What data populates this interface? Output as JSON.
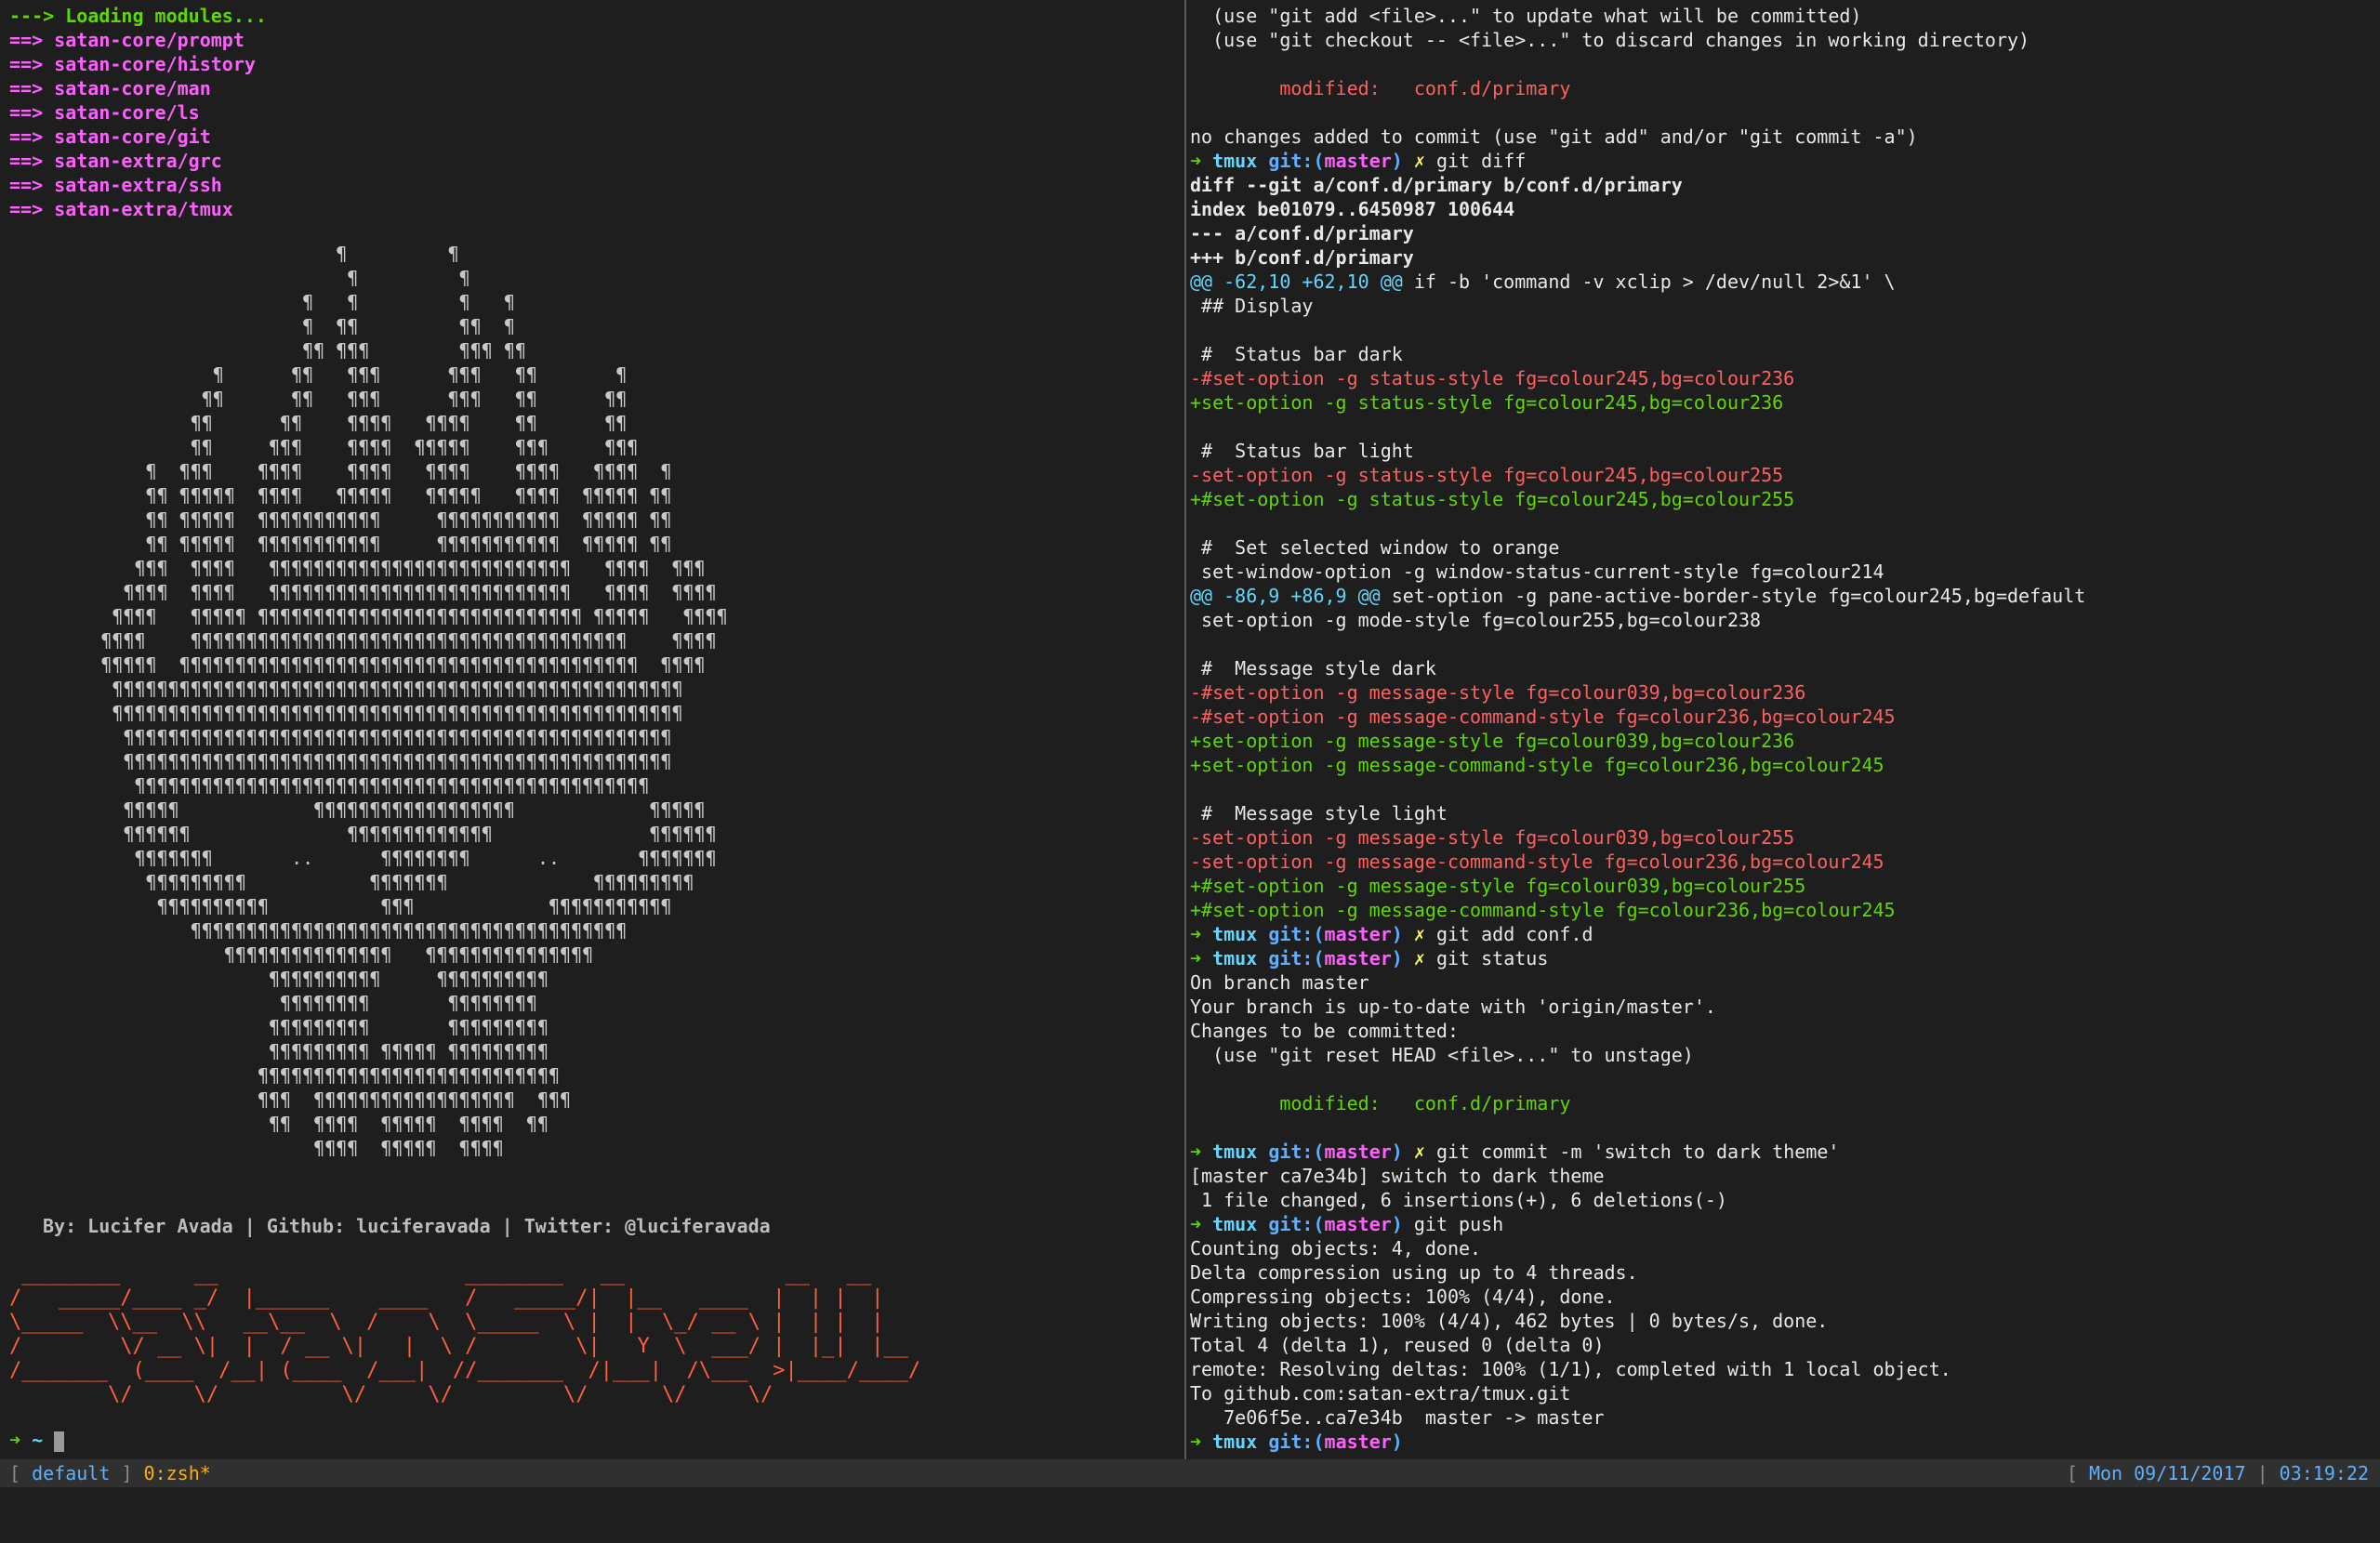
{
  "left": {
    "loading": [
      {
        "arrow": "--->",
        "text": "Loading modules...",
        "cls": "green"
      },
      {
        "arrow": "==>",
        "text": "satan-core/prompt",
        "cls": "magenta"
      },
      {
        "arrow": "==>",
        "text": "satan-core/history",
        "cls": "magenta"
      },
      {
        "arrow": "==>",
        "text": "satan-core/man",
        "cls": "magenta"
      },
      {
        "arrow": "==>",
        "text": "satan-core/ls",
        "cls": "magenta"
      },
      {
        "arrow": "==>",
        "text": "satan-core/git",
        "cls": "magenta"
      },
      {
        "arrow": "==>",
        "text": "satan-extra/grc",
        "cls": "magenta"
      },
      {
        "arrow": "==>",
        "text": "satan-extra/ssh",
        "cls": "magenta"
      },
      {
        "arrow": "==>",
        "text": "satan-extra/tmux",
        "cls": "magenta"
      }
    ],
    "skull_art": [
      "                              ¶         ¶",
      "                               ¶         ¶",
      "                           ¶   ¶         ¶   ¶",
      "                           ¶  ¶¶         ¶¶  ¶",
      "                           ¶¶ ¶¶¶        ¶¶¶ ¶¶",
      "                   ¶      ¶¶   ¶¶¶      ¶¶¶   ¶¶       ¶",
      "                  ¶¶      ¶¶   ¶¶¶      ¶¶¶   ¶¶      ¶¶",
      "                 ¶¶      ¶¶    ¶¶¶¶   ¶¶¶¶    ¶¶      ¶¶",
      "                 ¶¶     ¶¶¶    ¶¶¶¶  ¶¶¶¶¶    ¶¶¶     ¶¶¶",
      "             ¶  ¶¶¶    ¶¶¶¶    ¶¶¶¶   ¶¶¶¶    ¶¶¶¶   ¶¶¶¶  ¶",
      "             ¶¶ ¶¶¶¶¶  ¶¶¶¶   ¶¶¶¶¶   ¶¶¶¶¶   ¶¶¶¶  ¶¶¶¶¶ ¶¶",
      "             ¶¶ ¶¶¶¶¶  ¶¶¶¶¶¶¶¶¶¶¶     ¶¶¶¶¶¶¶¶¶¶¶  ¶¶¶¶¶ ¶¶",
      "             ¶¶ ¶¶¶¶¶  ¶¶¶¶¶¶¶¶¶¶¶     ¶¶¶¶¶¶¶¶¶¶¶  ¶¶¶¶¶ ¶¶",
      "            ¶¶¶  ¶¶¶¶   ¶¶¶¶¶¶¶¶¶¶¶¶¶¶¶¶¶¶¶¶¶¶¶¶¶¶¶   ¶¶¶¶  ¶¶¶",
      "           ¶¶¶¶  ¶¶¶¶   ¶¶¶¶¶¶¶¶¶¶¶¶¶¶¶¶¶¶¶¶¶¶¶¶¶¶¶   ¶¶¶¶  ¶¶¶¶",
      "          ¶¶¶¶   ¶¶¶¶¶ ¶¶¶¶¶¶¶¶¶¶¶¶¶¶¶¶¶¶¶¶¶¶¶¶¶¶¶¶¶ ¶¶¶¶¶   ¶¶¶¶",
      "         ¶¶¶¶    ¶¶¶¶¶¶¶¶¶¶¶¶¶¶¶¶¶¶¶¶¶¶¶¶¶¶¶¶¶¶¶¶¶¶¶¶¶¶¶    ¶¶¶¶",
      "         ¶¶¶¶¶  ¶¶¶¶¶¶¶¶¶¶¶¶¶¶¶¶¶¶¶¶¶¶¶¶¶¶¶¶¶¶¶¶¶¶¶¶¶¶¶¶¶  ¶¶¶¶",
      "          ¶¶¶¶¶¶¶¶¶¶¶¶¶¶¶¶¶¶¶¶¶¶¶¶¶¶¶¶¶¶¶¶¶¶¶¶¶¶¶¶¶¶¶¶¶¶¶¶¶¶¶",
      "          ¶¶¶¶¶¶¶¶¶¶¶¶¶¶¶¶¶¶¶¶¶¶¶¶¶¶¶¶¶¶¶¶¶¶¶¶¶¶¶¶¶¶¶¶¶¶¶¶¶¶¶",
      "           ¶¶¶¶¶¶¶¶¶¶¶¶¶¶¶¶¶¶¶¶¶¶¶¶¶¶¶¶¶¶¶¶¶¶¶¶¶¶¶¶¶¶¶¶¶¶¶¶¶",
      "           ¶¶¶¶¶¶¶¶¶¶¶¶¶¶¶¶¶¶¶¶¶¶¶¶¶¶¶¶¶¶¶¶¶¶¶¶¶¶¶¶¶¶¶¶¶¶¶¶¶",
      "            ¶¶¶¶¶¶¶¶¶¶¶¶¶¶¶¶¶¶¶¶¶¶¶¶¶¶¶¶¶¶¶¶¶¶¶¶¶¶¶¶¶¶¶¶¶¶",
      "           ¶¶¶¶¶            ¶¶¶¶¶¶¶¶¶¶¶¶¶¶¶¶¶¶            ¶¶¶¶¶",
      "           ¶¶¶¶¶¶              ¶¶¶¶¶¶¶¶¶¶¶¶¶              ¶¶¶¶¶¶",
      "            ¶¶¶¶¶¶¶       ..      ¶¶¶¶¶¶¶¶      ..       ¶¶¶¶¶¶¶",
      "             ¶¶¶¶¶¶¶¶¶           ¶¶¶¶¶¶¶             ¶¶¶¶¶¶¶¶¶",
      "              ¶¶¶¶¶¶¶¶¶¶          ¶¶¶            ¶¶¶¶¶¶¶¶¶¶¶",
      "                 ¶¶¶¶¶¶¶¶¶¶¶¶¶¶¶¶¶¶¶¶¶¶¶¶¶¶¶¶¶¶¶¶¶¶¶¶¶¶¶",
      "                    ¶¶¶¶¶¶¶¶¶¶¶¶¶¶¶   ¶¶¶¶¶¶¶¶¶¶¶¶¶¶¶",
      "                        ¶¶¶¶¶¶¶¶¶¶     ¶¶¶¶¶¶¶¶¶¶",
      "                         ¶¶¶¶¶¶¶¶       ¶¶¶¶¶¶¶¶",
      "                        ¶¶¶¶¶¶¶¶¶       ¶¶¶¶¶¶¶¶¶",
      "                        ¶¶¶¶¶¶¶¶¶ ¶¶¶¶¶ ¶¶¶¶¶¶¶¶¶",
      "                       ¶¶¶¶¶¶¶¶¶¶¶¶¶¶¶¶¶¶¶¶¶¶¶¶¶¶¶",
      "                       ¶¶¶  ¶¶¶¶¶¶¶¶¶¶¶¶¶¶¶¶¶¶  ¶¶¶",
      "                        ¶¶  ¶¶¶¶  ¶¶¶¶¶  ¶¶¶¶  ¶¶",
      "                            ¶¶¶¶  ¶¶¶¶¶  ¶¶¶¶"
    ],
    "credits": "By: Lucifer Avada | Github: luciferavada | Twitter: @luciferavada",
    "banner": [
      " ________      __                    ________   __             __   __",
      "/   _____/____ _/  |______    ____   /   _____/|  |__   ____  |  | |  |",
      "\\_____  \\\\__  \\\\   __\\__  \\  /    \\  \\_____  \\ |  |  \\_/ __ \\ |  | |  |",
      "/        \\/ __ \\|  |  / __ \\|   |  \\ /        \\|   Y  \\  ___/ |  |_|  |__",
      "/_______  (____  /__| (____  /___|  //_______  /|___|  /\\___  >|____/____/",
      "        \\/     \\/          \\/     \\/         \\/      \\/     \\/"
    ],
    "prompt_arrow": "➜",
    "prompt_dir": "~"
  },
  "right": {
    "lines": [
      {
        "segs": [
          {
            "t": "  (use \"git add <file>...\" to update what will be committed)"
          }
        ]
      },
      {
        "segs": [
          {
            "t": "  (use \"git checkout -- <file>...\" to discard changes in working directory)"
          }
        ]
      },
      {
        "segs": [
          {
            "t": ""
          }
        ]
      },
      {
        "segs": [
          {
            "t": "        modified:   conf.d/primary",
            "c": "red"
          }
        ]
      },
      {
        "segs": [
          {
            "t": ""
          }
        ]
      },
      {
        "segs": [
          {
            "t": "no changes added to commit (use \"git add\" and/or \"git commit -a\")"
          }
        ]
      },
      {
        "segs": [
          {
            "t": "➜ ",
            "c": "green b"
          },
          {
            "t": "tmux ",
            "c": "cyan b"
          },
          {
            "t": "git:(",
            "c": "blue b"
          },
          {
            "t": "master",
            "c": "magenta b"
          },
          {
            "t": ") ",
            "c": "blue b"
          },
          {
            "t": "✗ ",
            "c": "yellow b"
          },
          {
            "t": "git diff"
          }
        ]
      },
      {
        "segs": [
          {
            "t": "diff --git a/conf.d/primary b/conf.d/primary",
            "c": "b"
          }
        ]
      },
      {
        "segs": [
          {
            "t": "index be01079..6450987 100644",
            "c": "b"
          }
        ]
      },
      {
        "segs": [
          {
            "t": "--- a/conf.d/primary",
            "c": "b"
          }
        ]
      },
      {
        "segs": [
          {
            "t": "+++ b/conf.d/primary",
            "c": "b"
          }
        ]
      },
      {
        "segs": [
          {
            "t": "@@ -62,10 +62,10 @@",
            "c": "cyan"
          },
          {
            "t": " if -b 'command -v xclip > /dev/null 2>&1' \\"
          }
        ]
      },
      {
        "segs": [
          {
            "t": " ## Display"
          }
        ]
      },
      {
        "segs": [
          {
            "t": ""
          }
        ]
      },
      {
        "segs": [
          {
            "t": " #  Status bar dark"
          }
        ]
      },
      {
        "segs": [
          {
            "t": "-#set-option -g status-style fg=colour245,bg=colour236",
            "c": "red"
          }
        ]
      },
      {
        "segs": [
          {
            "t": "+set-option -g status-style fg=colour245,bg=colour236",
            "c": "green"
          }
        ]
      },
      {
        "segs": [
          {
            "t": ""
          }
        ]
      },
      {
        "segs": [
          {
            "t": " #  Status bar light"
          }
        ]
      },
      {
        "segs": [
          {
            "t": "-set-option -g status-style fg=colour245,bg=colour255",
            "c": "red"
          }
        ]
      },
      {
        "segs": [
          {
            "t": "+#set-option -g status-style fg=colour245,bg=colour255",
            "c": "green"
          }
        ]
      },
      {
        "segs": [
          {
            "t": ""
          }
        ]
      },
      {
        "segs": [
          {
            "t": " #  Set selected window to orange"
          }
        ]
      },
      {
        "segs": [
          {
            "t": " set-window-option -g window-status-current-style fg=colour214"
          }
        ]
      },
      {
        "segs": [
          {
            "t": "@@ -86,9 +86,9 @@",
            "c": "cyan"
          },
          {
            "t": " set-option -g pane-active-border-style fg=colour245,bg=default"
          }
        ]
      },
      {
        "segs": [
          {
            "t": " set-option -g mode-style fg=colour255,bg=colour238"
          }
        ]
      },
      {
        "segs": [
          {
            "t": ""
          }
        ]
      },
      {
        "segs": [
          {
            "t": " #  Message style dark"
          }
        ]
      },
      {
        "segs": [
          {
            "t": "-#set-option -g message-style fg=colour039,bg=colour236",
            "c": "red"
          }
        ]
      },
      {
        "segs": [
          {
            "t": "-#set-option -g message-command-style fg=colour236,bg=colour245",
            "c": "red"
          }
        ]
      },
      {
        "segs": [
          {
            "t": "+set-option -g message-style fg=colour039,bg=colour236",
            "c": "green"
          }
        ]
      },
      {
        "segs": [
          {
            "t": "+set-option -g message-command-style fg=colour236,bg=colour245",
            "c": "green"
          }
        ]
      },
      {
        "segs": [
          {
            "t": ""
          }
        ]
      },
      {
        "segs": [
          {
            "t": " #  Message style light"
          }
        ]
      },
      {
        "segs": [
          {
            "t": "-set-option -g message-style fg=colour039,bg=colour255",
            "c": "red"
          }
        ]
      },
      {
        "segs": [
          {
            "t": "-set-option -g message-command-style fg=colour236,bg=colour245",
            "c": "red"
          }
        ]
      },
      {
        "segs": [
          {
            "t": "+#set-option -g message-style fg=colour039,bg=colour255",
            "c": "green"
          }
        ]
      },
      {
        "segs": [
          {
            "t": "+#set-option -g message-command-style fg=colour236,bg=colour245",
            "c": "green"
          }
        ]
      },
      {
        "segs": [
          {
            "t": "➜ ",
            "c": "green b"
          },
          {
            "t": "tmux ",
            "c": "cyan b"
          },
          {
            "t": "git:(",
            "c": "blue b"
          },
          {
            "t": "master",
            "c": "magenta b"
          },
          {
            "t": ") ",
            "c": "blue b"
          },
          {
            "t": "✗ ",
            "c": "yellow b"
          },
          {
            "t": "git add conf.d"
          }
        ]
      },
      {
        "segs": [
          {
            "t": "➜ ",
            "c": "green b"
          },
          {
            "t": "tmux ",
            "c": "cyan b"
          },
          {
            "t": "git:(",
            "c": "blue b"
          },
          {
            "t": "master",
            "c": "magenta b"
          },
          {
            "t": ") ",
            "c": "blue b"
          },
          {
            "t": "✗ ",
            "c": "yellow b"
          },
          {
            "t": "git status"
          }
        ]
      },
      {
        "segs": [
          {
            "t": "On branch master"
          }
        ]
      },
      {
        "segs": [
          {
            "t": "Your branch is up-to-date with 'origin/master'."
          }
        ]
      },
      {
        "segs": [
          {
            "t": "Changes to be committed:"
          }
        ]
      },
      {
        "segs": [
          {
            "t": "  (use \"git reset HEAD <file>...\" to unstage)"
          }
        ]
      },
      {
        "segs": [
          {
            "t": ""
          }
        ]
      },
      {
        "segs": [
          {
            "t": "        modified:   conf.d/primary",
            "c": "green"
          }
        ]
      },
      {
        "segs": [
          {
            "t": ""
          }
        ]
      },
      {
        "segs": [
          {
            "t": "➜ ",
            "c": "green b"
          },
          {
            "t": "tmux ",
            "c": "cyan b"
          },
          {
            "t": "git:(",
            "c": "blue b"
          },
          {
            "t": "master",
            "c": "magenta b"
          },
          {
            "t": ") ",
            "c": "blue b"
          },
          {
            "t": "✗ ",
            "c": "yellow b"
          },
          {
            "t": "git commit -m 'switch to dark theme'"
          }
        ]
      },
      {
        "segs": [
          {
            "t": "[master ca7e34b] switch to dark theme"
          }
        ]
      },
      {
        "segs": [
          {
            "t": " 1 file changed, 6 insertions(+), 6 deletions(-)"
          }
        ]
      },
      {
        "segs": [
          {
            "t": "➜ ",
            "c": "green b"
          },
          {
            "t": "tmux ",
            "c": "cyan b"
          },
          {
            "t": "git:(",
            "c": "blue b"
          },
          {
            "t": "master",
            "c": "magenta b"
          },
          {
            "t": ") ",
            "c": "blue b"
          },
          {
            "t": "git push"
          }
        ]
      },
      {
        "segs": [
          {
            "t": "Counting objects: 4, done."
          }
        ]
      },
      {
        "segs": [
          {
            "t": "Delta compression using up to 4 threads."
          }
        ]
      },
      {
        "segs": [
          {
            "t": "Compressing objects: 100% (4/4), done."
          }
        ]
      },
      {
        "segs": [
          {
            "t": "Writing objects: 100% (4/4), 462 bytes | 0 bytes/s, done."
          }
        ]
      },
      {
        "segs": [
          {
            "t": "Total 4 (delta 1), reused 0 (delta 0)"
          }
        ]
      },
      {
        "segs": [
          {
            "t": "remote: Resolving deltas: 100% (1/1), completed with 1 local object."
          }
        ]
      },
      {
        "segs": [
          {
            "t": "To github.com:satan-extra/tmux.git"
          }
        ]
      },
      {
        "segs": [
          {
            "t": "   7e06f5e..ca7e34b  master -> master"
          }
        ]
      },
      {
        "segs": [
          {
            "t": "➜ ",
            "c": "green b"
          },
          {
            "t": "tmux ",
            "c": "cyan b"
          },
          {
            "t": "git:(",
            "c": "blue b"
          },
          {
            "t": "master",
            "c": "magenta b"
          },
          {
            "t": ")",
            "c": "blue b"
          }
        ]
      }
    ]
  },
  "statusbar": {
    "open_bracket": "[",
    "session": "default",
    "close_bracket": "]",
    "window": "0:zsh*",
    "date": "Mon 09/11/2017",
    "separator": "|",
    "time": "03:19:22"
  }
}
